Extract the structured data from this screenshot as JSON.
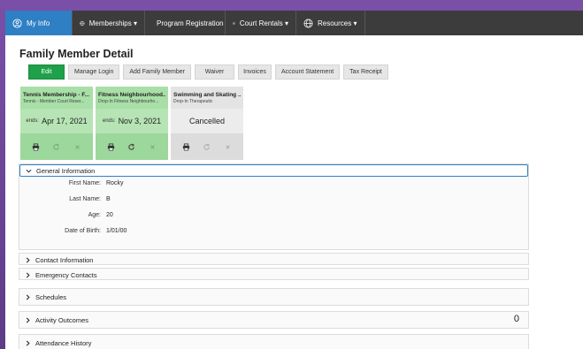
{
  "nav": {
    "items": [
      {
        "label": "My Info",
        "icon": "person-circle-icon",
        "active": true
      },
      {
        "label": "Memberships ▾",
        "icon": "globe-icon"
      },
      {
        "label": "Program Registration",
        "icon": "calendar-check-icon"
      },
      {
        "label": "Court Rentals ▾",
        "icon": "globe-icon"
      },
      {
        "label": "Resources ▾",
        "icon": "globe-icon"
      }
    ]
  },
  "page": {
    "title": "Family Member Detail"
  },
  "actions": {
    "edit": "Edit",
    "manage_login": "Manage Login",
    "add_family_member": "Add Family Member",
    "waiver": "Waiver",
    "invoices": "Invoices",
    "account_statement": "Account Statement",
    "tax_receipt": "Tax Receipt"
  },
  "cards": [
    {
      "name": "Tennis Membership - F...",
      "sub": "Tennis - Member Court Reser...",
      "ends_label": "ends:",
      "ends_date": "Apr 17, 2021",
      "status": "active"
    },
    {
      "name": "Fitness Neighbourhood...",
      "sub": "Drop-In Fitness Neighbourho...",
      "ends_label": "ends:",
      "ends_date": "Nov 3, 2021",
      "status": "active"
    },
    {
      "name": "Swimming and Skating ...",
      "sub": "Drop-In Therapeutic",
      "status_text": "Cancelled",
      "status": "cancelled"
    }
  ],
  "general": {
    "title": "General Information",
    "fields": [
      {
        "label": "First Name:",
        "value": "Rocky"
      },
      {
        "label": "Last Name:",
        "value": "B"
      },
      {
        "label": "Age:",
        "value": "20"
      },
      {
        "label": "Date of Birth:",
        "value": "1/01/00"
      }
    ]
  },
  "sections": {
    "contact": "Contact Information",
    "emergency": "Emergency Contacts",
    "schedules": "Schedules",
    "activity_outcomes": "Activity Outcomes",
    "activity_outcomes_count": "0",
    "attendance": "Attendance History"
  },
  "colors": {
    "accent": "#2f7fc4",
    "primary_button": "#1fa04a",
    "nav_bg": "#3c3c3c",
    "frame_purple": "#7a4fa8",
    "card_green": "#a8dfa7",
    "card_gray": "#e4e4e4"
  }
}
